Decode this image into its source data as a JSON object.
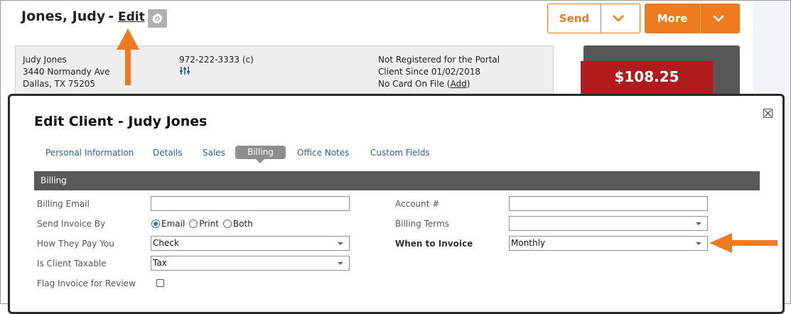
{
  "header": {
    "client_name": "Jones, Judy",
    "separator": "-",
    "edit_label": "Edit",
    "send_label": "Send",
    "more_label": "More"
  },
  "client_info": {
    "name": "Judy Jones",
    "address_line1": "3440 Normandy Ave",
    "address_line2": "Dallas, TX 75205",
    "phone": "972-222-3333 (c)",
    "portal_status": "Not Registered for the Portal",
    "client_since": "Client Since  01/02/2018",
    "card_status": "No Card On File (",
    "card_add_link": "Add",
    "card_status_end": ")"
  },
  "balance": {
    "amount": "$108.25"
  },
  "modal": {
    "title": "Edit Client - Judy Jones",
    "tabs": [
      {
        "label": "Personal Information"
      },
      {
        "label": "Details"
      },
      {
        "label": "Sales"
      },
      {
        "label": "Billing",
        "active": true
      },
      {
        "label": "Office Notes"
      },
      {
        "label": "Custom Fields"
      }
    ],
    "section_title": "Billing",
    "fields": {
      "billing_email": {
        "label": "Billing Email",
        "value": ""
      },
      "send_invoice_by": {
        "label": "Send Invoice By",
        "options": [
          "Email",
          "Print",
          "Both"
        ],
        "selected": "Email"
      },
      "how_they_pay": {
        "label": "How They Pay You",
        "value": "Check"
      },
      "is_taxable": {
        "label": "Is Client Taxable",
        "value": "Tax"
      },
      "flag_review": {
        "label": "Flag Invoice for Review",
        "checked": false
      },
      "account_number": {
        "label": "Account #",
        "value": ""
      },
      "billing_terms": {
        "label": "Billing Terms",
        "value": ""
      },
      "when_to_invoice": {
        "label": "When to Invoice",
        "value": "Monthly"
      }
    }
  },
  "colors": {
    "accent_orange": "#ef7b20",
    "balance_red": "#b01c1c",
    "tab_active": "#8e8e8e",
    "section_bar": "#5a5a5a"
  }
}
